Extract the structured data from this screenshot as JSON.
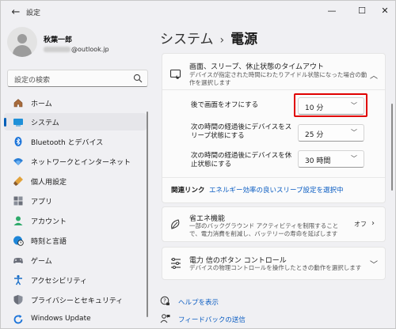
{
  "window": {
    "back_glyph": "←",
    "title": "設定",
    "min_glyph": "—",
    "max_glyph": "☐",
    "close_glyph": "✕"
  },
  "user": {
    "name": "秋葉一郎",
    "email_suffix": "@outlook.jp"
  },
  "search": {
    "placeholder": "設定の検索"
  },
  "sidebar": {
    "items": [
      {
        "label": "ホーム",
        "icon": "home-icon"
      },
      {
        "label": "システム",
        "icon": "system-icon",
        "active": true
      },
      {
        "label": "Bluetooth とデバイス",
        "icon": "bluetooth-icon"
      },
      {
        "label": "ネットワークとインターネット",
        "icon": "wifi-icon"
      },
      {
        "label": "個人用設定",
        "icon": "paint-icon"
      },
      {
        "label": "アプリ",
        "icon": "apps-icon"
      },
      {
        "label": "アカウント",
        "icon": "account-icon"
      },
      {
        "label": "時刻と言語",
        "icon": "globe-clock-icon"
      },
      {
        "label": "ゲーム",
        "icon": "gamepad-icon"
      },
      {
        "label": "アクセシビリティ",
        "icon": "accessibility-icon"
      },
      {
        "label": "プライバシーとセキュリティ",
        "icon": "shield-icon"
      },
      {
        "label": "Windows Update",
        "icon": "update-icon"
      }
    ]
  },
  "breadcrumb": {
    "parent": "システム",
    "separator": "›",
    "current": "電源"
  },
  "screen_sleep": {
    "title": "画面、スリープ、休止状態のタイムアウト",
    "description": "デバイスが指定された時間にわたりアイドル状態になった場合の動作を選択します",
    "rows": [
      {
        "label": "後で画面をオフにする",
        "value": "10 分"
      },
      {
        "label": "次の時間の経過後にデバイスをスリープ状態にする",
        "value": "25 分"
      },
      {
        "label": "次の時間の経過後にデバイスを休止状態にする",
        "value": "30 時間"
      }
    ],
    "related_label": "関連リンク",
    "related_link": "エネルギー効率の良いスリープ設定を選択中"
  },
  "energy_saver": {
    "title": "省エネ機能",
    "description": "一部のバックグラウンド アクティビティを制限することで、電力消費を削減し、バッテリーの寿命を延ばします",
    "state": "オフ"
  },
  "power_button": {
    "title": "電力 信のボタン コントロール",
    "description": "デバイスの物理コントロールを操作したときの動作を選択します"
  },
  "help": {
    "get_help": "ヘルプを表示",
    "feedback": "フィードバックの送信"
  },
  "colors": {
    "accent": "#005fb8",
    "highlight": "#e00000",
    "link": "#0a5cc2"
  }
}
